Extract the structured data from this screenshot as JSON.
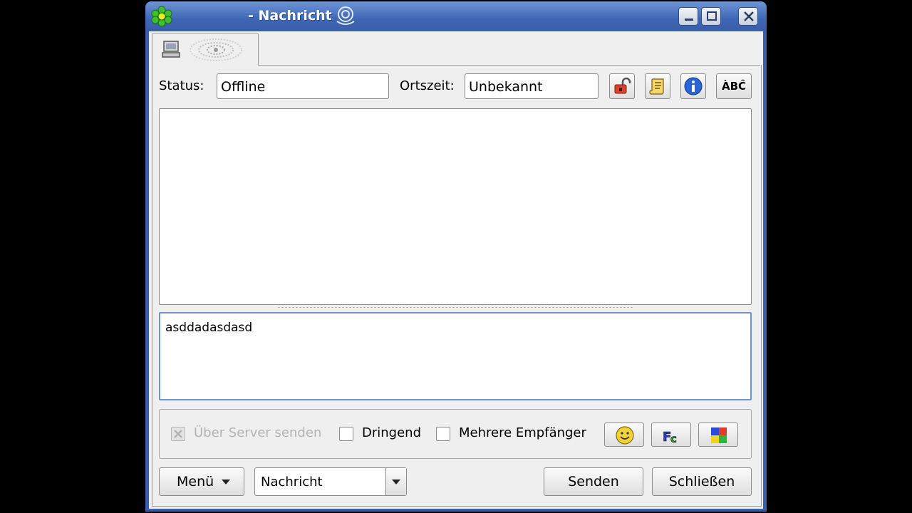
{
  "window": {
    "title": "- Nachricht",
    "controls": {
      "minimize": "minimize",
      "maximize": "maximize",
      "close": "close"
    }
  },
  "header": {
    "status_label": "Status:",
    "status_value": "Offline",
    "time_label": "Ortszeit:",
    "time_value": "Unbekannt",
    "spellcheck_label": "ÀBĈ"
  },
  "compose": {
    "text": "asddadasdasd"
  },
  "options": {
    "via_server": {
      "label": "Über Server senden",
      "checked": true,
      "enabled": false
    },
    "urgent": {
      "label": "Dringend",
      "checked": false
    },
    "multiple_recipients": {
      "label": "Mehrere Empfänger",
      "checked": false
    }
  },
  "footer": {
    "menu_label": "Menü",
    "type_select_value": "Nachricht",
    "send_label": "Senden",
    "close_label": "Schließen"
  },
  "colors": {
    "titlebar": "#3a5ea8",
    "focus_border": "#6f94d0",
    "background": "#efefef"
  }
}
